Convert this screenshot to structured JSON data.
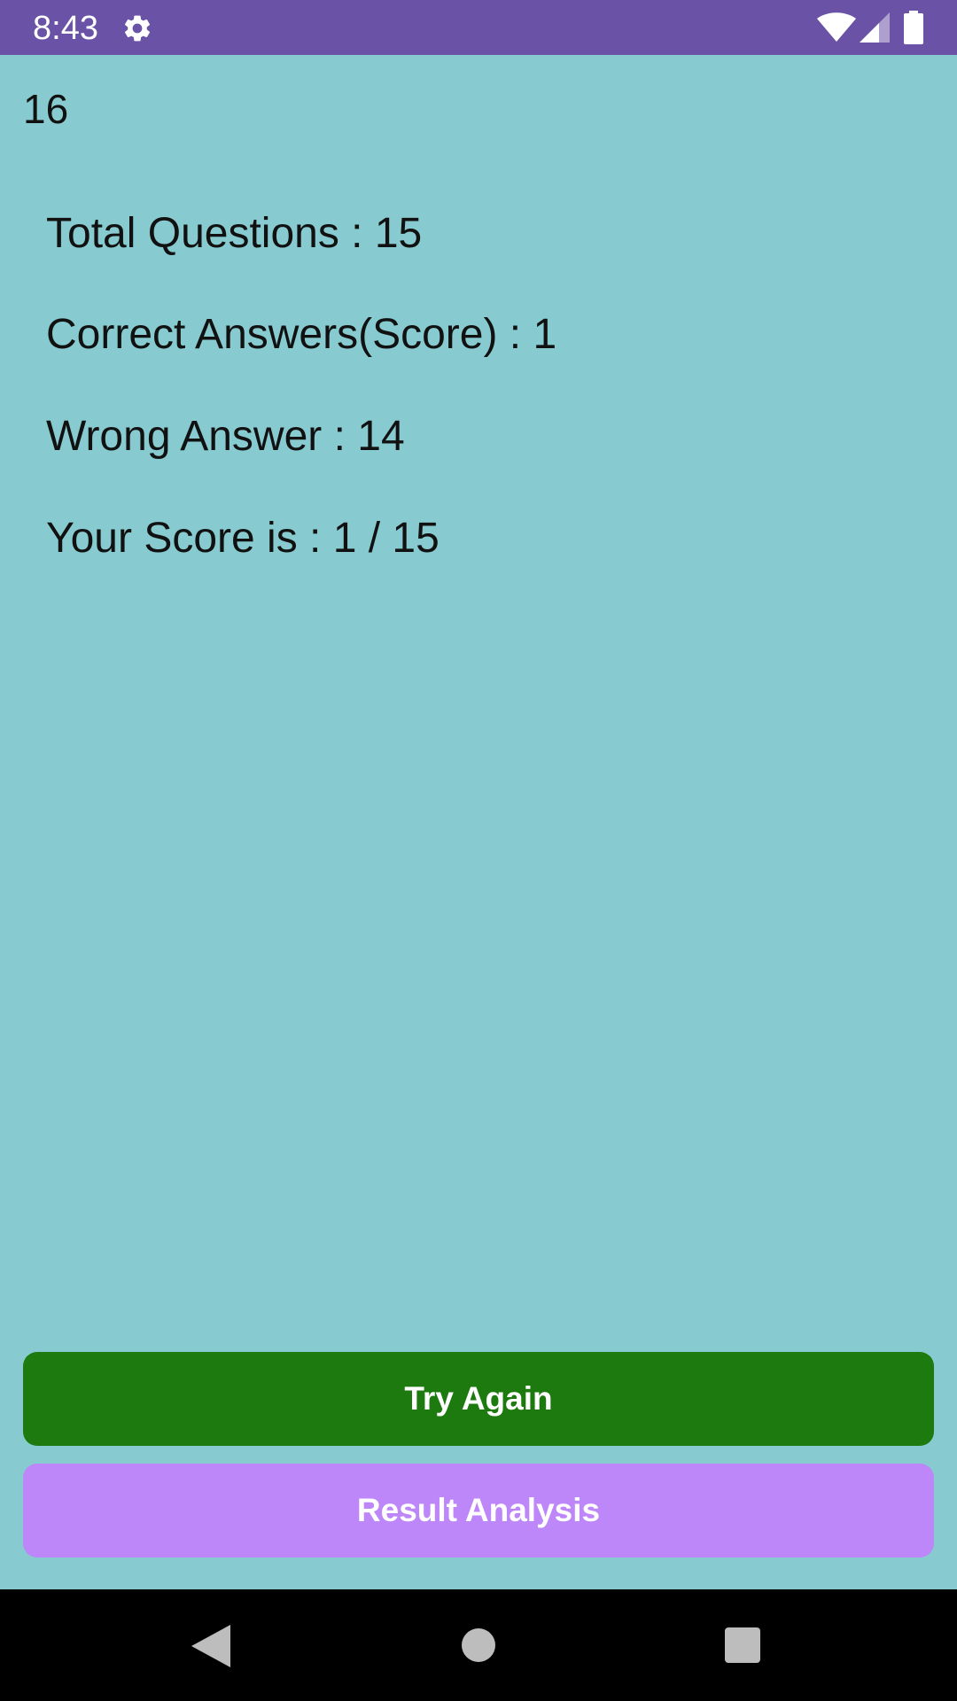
{
  "status_bar": {
    "time": "8:43",
    "icons": [
      "gear-icon",
      "wifi-icon",
      "signal-icon",
      "battery-icon"
    ],
    "background": "#6A53A6"
  },
  "quiz_result": {
    "counter": "16",
    "total_questions": "Total Questions : 15",
    "correct_answers": "Correct Answers(Score) : 1",
    "wrong_answers": "Wrong Answer : 14",
    "score": "Your Score is : 1 / 15"
  },
  "buttons": {
    "try_again": "Try Again",
    "result_analysis": "Result Analysis"
  },
  "navigation": {
    "icons": [
      "back-icon",
      "home-icon",
      "recents-icon"
    ]
  },
  "colors": {
    "background": "#87CBD0",
    "try_again_button": "#1C7A0E",
    "result_analysis_button": "#BD86F9",
    "nav_bar": "#000000"
  }
}
